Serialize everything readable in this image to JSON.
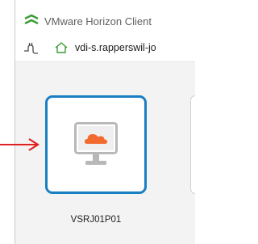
{
  "window": {
    "title": "VMware Horizon Client"
  },
  "toolbar": {
    "server_address": "vdi-s.rapperswil-jo"
  },
  "desktops": [
    {
      "name": "VSRJ01P01",
      "selected": true
    }
  ],
  "colors": {
    "selection_border": "#1a7fc2",
    "callout_arrow": "#e02020",
    "logo_green": "#3a9b35",
    "monitor_cloud": "#f26a2e"
  }
}
